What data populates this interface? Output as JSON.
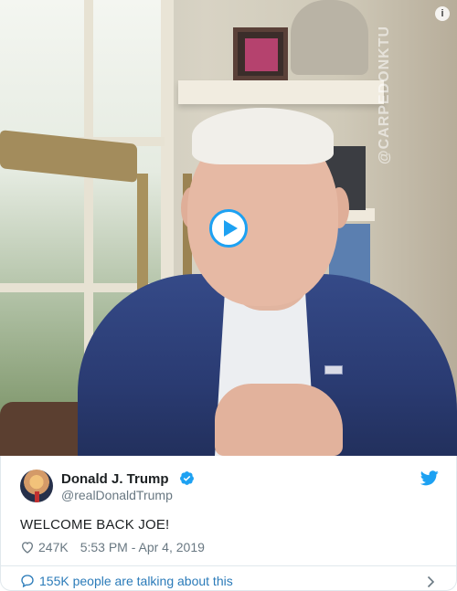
{
  "media": {
    "watermark": "@CARPEDONKTUM",
    "info_symbol": "i",
    "accent_color": "#1da1f2"
  },
  "tweet": {
    "author_name": "Donald J. Trump",
    "author_handle": "@realDonaldTrump",
    "verified": true,
    "text": "WELCOME BACK JOE!",
    "likes": "247K",
    "timestamp": "5:53 PM - Apr 4, 2019",
    "conversation": "155K people are talking about this"
  },
  "icons": {
    "play": "play-icon",
    "info": "info-icon",
    "verified": "verified-badge-icon",
    "twitter": "twitter-bird-icon",
    "like": "heart-icon",
    "reply": "speech-bubble-icon",
    "more": "chevron-right-icon"
  },
  "colors": {
    "link": "#2b7bb9",
    "muted": "#697882",
    "text": "#1c2022",
    "border": "#e1e8ed"
  }
}
